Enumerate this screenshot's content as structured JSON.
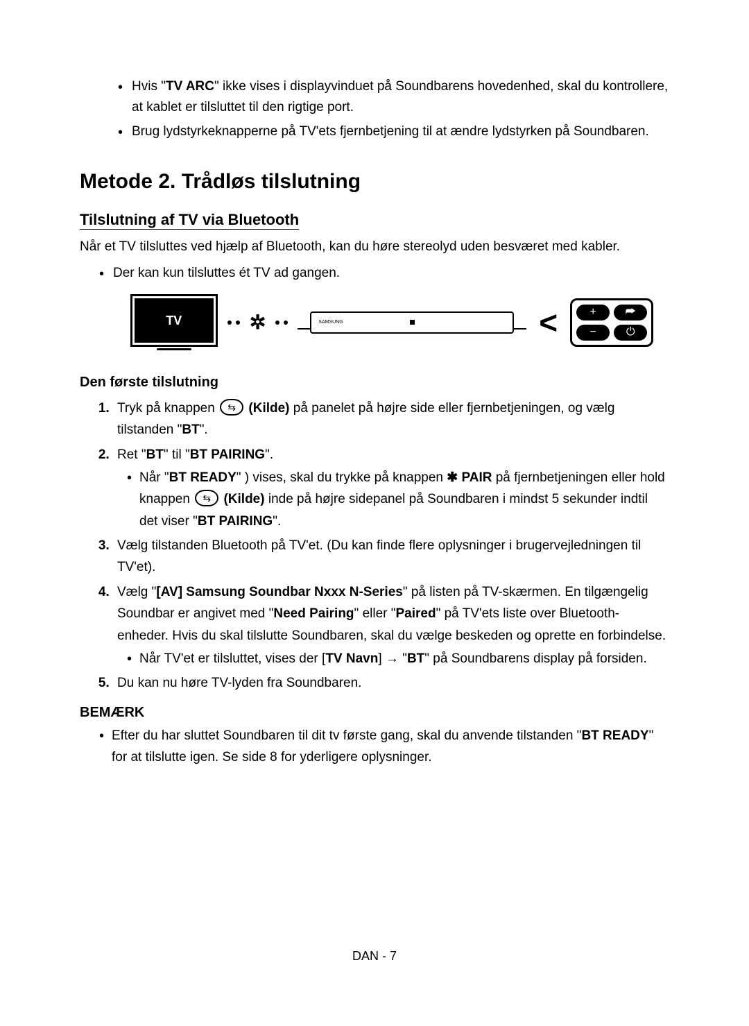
{
  "topBullets": [
    {
      "prefix": "Hvis \"",
      "bold1": "TV ARC",
      "suffix": "\" ikke vises i displayvinduet på Soundbarens hovedenhed, skal du kontrollere, at kablet er tilsluttet til den rigtige port."
    },
    {
      "text": "Brug lydstyrkeknapperne på TV'ets fjernbetjening til at ændre lydstyrken på Soundbaren."
    }
  ],
  "methodTitle": "Metode 2. Trådløs tilslutning",
  "subTitle": "Tilslutning af TV via Bluetooth",
  "intro": "Når et TV tilsluttes ved hjælp af Bluetooth, kan du høre stereolyd uden besværet med kabler.",
  "singleBullet": "Der kan kun tilsluttes ét TV ad gangen.",
  "diagram": {
    "tvLabel": "TV",
    "remote": {
      "plus": "+",
      "source": "⮫",
      "minus": "−",
      "power": "⏻"
    }
  },
  "stepTitle": "Den første tilslutning",
  "steps": {
    "s1": {
      "pre": "Tryk på knappen ",
      "kilde": "(Kilde)",
      "post": " på panelet på højre side eller fjernbetjeningen, og vælg tilstanden \"",
      "bt": "BT",
      "end": "\"."
    },
    "s2": {
      "pre": "Ret \"",
      "bt": "BT",
      "mid": "\" til \"",
      "btp": "BT PAIRING",
      "end": "\".",
      "sub": {
        "pre": "Når  \"",
        "btready": "BT READY",
        "mid1": "\" ) vises, skal du trykke på knappen ",
        "pairIcon": "✱",
        "pair": "PAIR",
        "mid2": " på fjernbetjeningen eller hold knappen ",
        "kilde": "(Kilde)",
        "mid3": " inde på højre sidepanel på Soundbaren i mindst 5 sekunder indtil det viser \"",
        "btp": "BT PAIRING",
        "end": "\"."
      }
    },
    "s3": "Vælg tilstanden Bluetooth på TV'et. (Du kan finde flere oplysninger i brugervejledningen til TV'et).",
    "s4": {
      "pre": "Vælg \"",
      "bold1": "[AV] Samsung Soundbar Nxxx N-Series",
      "mid1": "\" på listen på TV-skærmen. En tilgængelig Soundbar er angivet med \"",
      "bold2": "Need Pairing",
      "mid2": "\" eller \"",
      "bold3": "Paired",
      "mid3": "\"  på TV'ets liste over Bluetooth-enheder. Hvis du skal tilslutte Soundbaren, skal du vælge beskeden og oprette en forbindelse.",
      "sub": {
        "pre": "Når TV'et er tilsluttet, vises der [",
        "tvnavn": "TV Navn",
        "arrow": "] → \"",
        "bt": "BT",
        "end": "\" på Soundbarens display på forsiden."
      }
    },
    "s5": "Du kan nu høre TV-lyden fra Soundbaren."
  },
  "noteTitle": "BEMÆRK",
  "note": {
    "pre": "Efter du har sluttet Soundbaren til dit tv første gang, skal du anvende tilstanden \"",
    "btready": "BT READY",
    "end": "\" for at tilslutte igen.  Se side 8 for yderligere oplysninger."
  },
  "footer": "DAN - 7"
}
